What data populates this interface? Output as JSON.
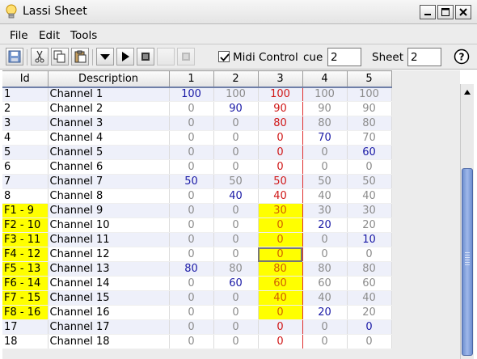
{
  "window": {
    "title": "Lassi Sheet",
    "icon": "lightbulb-icon"
  },
  "menu": [
    "File",
    "Edit",
    "Tools"
  ],
  "toolbar": {
    "buttons": [
      "save-icon",
      "cut-icon",
      "copy-icon",
      "paste-icon",
      "dropdown-icon",
      "play-icon",
      "stop-icon",
      "blank-icon",
      "stop-disabled-icon"
    ],
    "midi_control_label": "Midi Control",
    "midi_control_checked": true,
    "cue_label": "cue",
    "cue_value": "2",
    "sheet_label": "Sheet",
    "sheet_value": "2",
    "help_icon": "help-icon"
  },
  "table": {
    "headers": [
      "Id",
      "Description",
      "1",
      "2",
      "3",
      "4",
      "5"
    ],
    "active_column": "3",
    "rows": [
      {
        "id": "1",
        "desc": "Channel 1",
        "vals": [
          "100",
          "100",
          "100",
          "100",
          "100"
        ]
      },
      {
        "id": "2",
        "desc": "Channel 2",
        "vals": [
          "0",
          "90",
          "90",
          "90",
          "90"
        ]
      },
      {
        "id": "3",
        "desc": "Channel 3",
        "vals": [
          "0",
          "0",
          "80",
          "80",
          "80"
        ]
      },
      {
        "id": "4",
        "desc": "Channel 4",
        "vals": [
          "0",
          "0",
          "0",
          "70",
          "70"
        ]
      },
      {
        "id": "5",
        "desc": "Channel 5",
        "vals": [
          "0",
          "0",
          "0",
          "0",
          "60"
        ]
      },
      {
        "id": "6",
        "desc": "Channel 6",
        "vals": [
          "0",
          "0",
          "0",
          "0",
          "0"
        ]
      },
      {
        "id": "7",
        "desc": "Channel 7",
        "vals": [
          "50",
          "50",
          "50",
          "50",
          "50"
        ]
      },
      {
        "id": "8",
        "desc": "Channel 8",
        "vals": [
          "0",
          "40",
          "40",
          "40",
          "40"
        ]
      },
      {
        "id": "F1 - 9",
        "desc": "Channel 9",
        "vals": [
          "0",
          "0",
          "30",
          "30",
          "30"
        ]
      },
      {
        "id": "F2 - 10",
        "desc": "Channel 10",
        "vals": [
          "0",
          "0",
          "0",
          "20",
          "20"
        ]
      },
      {
        "id": "F3 - 11",
        "desc": "Channel 11",
        "vals": [
          "0",
          "0",
          "0",
          "0",
          "10"
        ]
      },
      {
        "id": "F4 - 12",
        "desc": "Channel 12",
        "vals": [
          "0",
          "0",
          "0",
          "0",
          "0"
        ]
      },
      {
        "id": "F5 - 13",
        "desc": "Channel 13",
        "vals": [
          "80",
          "80",
          "80",
          "80",
          "80"
        ]
      },
      {
        "id": "F6 - 14",
        "desc": "Channel 14",
        "vals": [
          "0",
          "60",
          "60",
          "60",
          "60"
        ]
      },
      {
        "id": "F7 - 15",
        "desc": "Channel 15",
        "vals": [
          "0",
          "0",
          "40",
          "40",
          "40"
        ]
      },
      {
        "id": "F8 - 16",
        "desc": "Channel 16",
        "vals": [
          "0",
          "0",
          "0",
          "20",
          "20"
        ]
      },
      {
        "id": "17",
        "desc": "Channel 17",
        "vals": [
          "0",
          "0",
          "0",
          "0",
          "0"
        ]
      },
      {
        "id": "18",
        "desc": "Channel 18",
        "vals": [
          "0",
          "0",
          "0",
          "0",
          "0"
        ]
      }
    ],
    "cell_styles": [
      [
        "blue",
        "gray",
        "red",
        "gray",
        "gray"
      ],
      [
        "gray",
        "blue",
        "red",
        "gray",
        "gray"
      ],
      [
        "gray",
        "gray",
        "red",
        "gray",
        "gray"
      ],
      [
        "gray",
        "gray",
        "red",
        "blue",
        "gray"
      ],
      [
        "gray",
        "gray",
        "red",
        "gray",
        "blue"
      ],
      [
        "gray",
        "gray",
        "red",
        "gray",
        "gray"
      ],
      [
        "blue",
        "gray",
        "red",
        "gray",
        "gray"
      ],
      [
        "gray",
        "blue",
        "red",
        "gray",
        "gray"
      ],
      [
        "gray",
        "gray",
        "orange",
        "gray",
        "gray"
      ],
      [
        "gray",
        "gray",
        "orange",
        "blue",
        "gray"
      ],
      [
        "gray",
        "gray",
        "orange",
        "gray",
        "blue"
      ],
      [
        "gray",
        "gray",
        "orange",
        "gray",
        "gray"
      ],
      [
        "blue",
        "gray",
        "orange",
        "gray",
        "gray"
      ],
      [
        "gray",
        "blue",
        "orange",
        "gray",
        "gray"
      ],
      [
        "gray",
        "gray",
        "orange",
        "gray",
        "gray"
      ],
      [
        "gray",
        "gray",
        "orange",
        "blue",
        "gray"
      ],
      [
        "gray",
        "gray",
        "red",
        "gray",
        "blue"
      ],
      [
        "gray",
        "gray",
        "red",
        "gray",
        "gray"
      ]
    ],
    "highlighted_active_rows": [
      8,
      9,
      10,
      11,
      12,
      13,
      14,
      15
    ],
    "focused_row": 11
  },
  "colors": {
    "blue": "#1a1aa6",
    "gray": "#8c8c8c",
    "red": "#d01818",
    "orange": "#d06000",
    "fkey_bg": "#ffff00",
    "active_border": "#e03030"
  }
}
